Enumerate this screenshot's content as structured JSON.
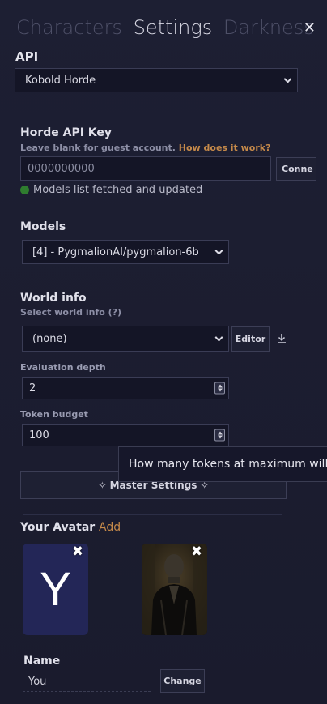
{
  "tabs": [
    "Characters",
    "Settings",
    "Darkness"
  ],
  "close_icon": "close-icon",
  "api": {
    "heading": "API",
    "selected": "Kobold Horde"
  },
  "horde": {
    "heading": "Horde API Key",
    "hint": "Leave blank for guest account.",
    "hint_link": "How does it work?",
    "key_value": "0000000000",
    "connect_label": "Conne",
    "status_text": "Models list fetched and updated",
    "status_color": "#2f7d2f"
  },
  "models": {
    "heading": "Models",
    "selected": "[4] - PygmalionAI/pygmalion-6b"
  },
  "world_info": {
    "heading": "World info",
    "hint": "Select world info",
    "hint_help": "(?)",
    "selected": "(none)",
    "editor_label": "Editor",
    "download_icon": "download-icon",
    "eval_depth_label": "Evaluation depth",
    "eval_depth_value": "2",
    "token_budget_label": "Token budget",
    "token_budget_value": "100"
  },
  "tooltip": "How many tokens at maximum will be",
  "master_settings_label": "✧ Master Settings ✧",
  "avatars": {
    "heading": "Your Avatar",
    "add_label": "Add",
    "items": [
      {
        "letter": "Y",
        "bg": "#232657"
      },
      {
        "letter": "",
        "bg": "#1c1812"
      }
    ]
  },
  "name": {
    "heading": "Name",
    "value": "You",
    "change_label": "Change"
  },
  "colors": {
    "accent_link": "#c68a4a",
    "panel_bg": "#1a1b2e"
  }
}
